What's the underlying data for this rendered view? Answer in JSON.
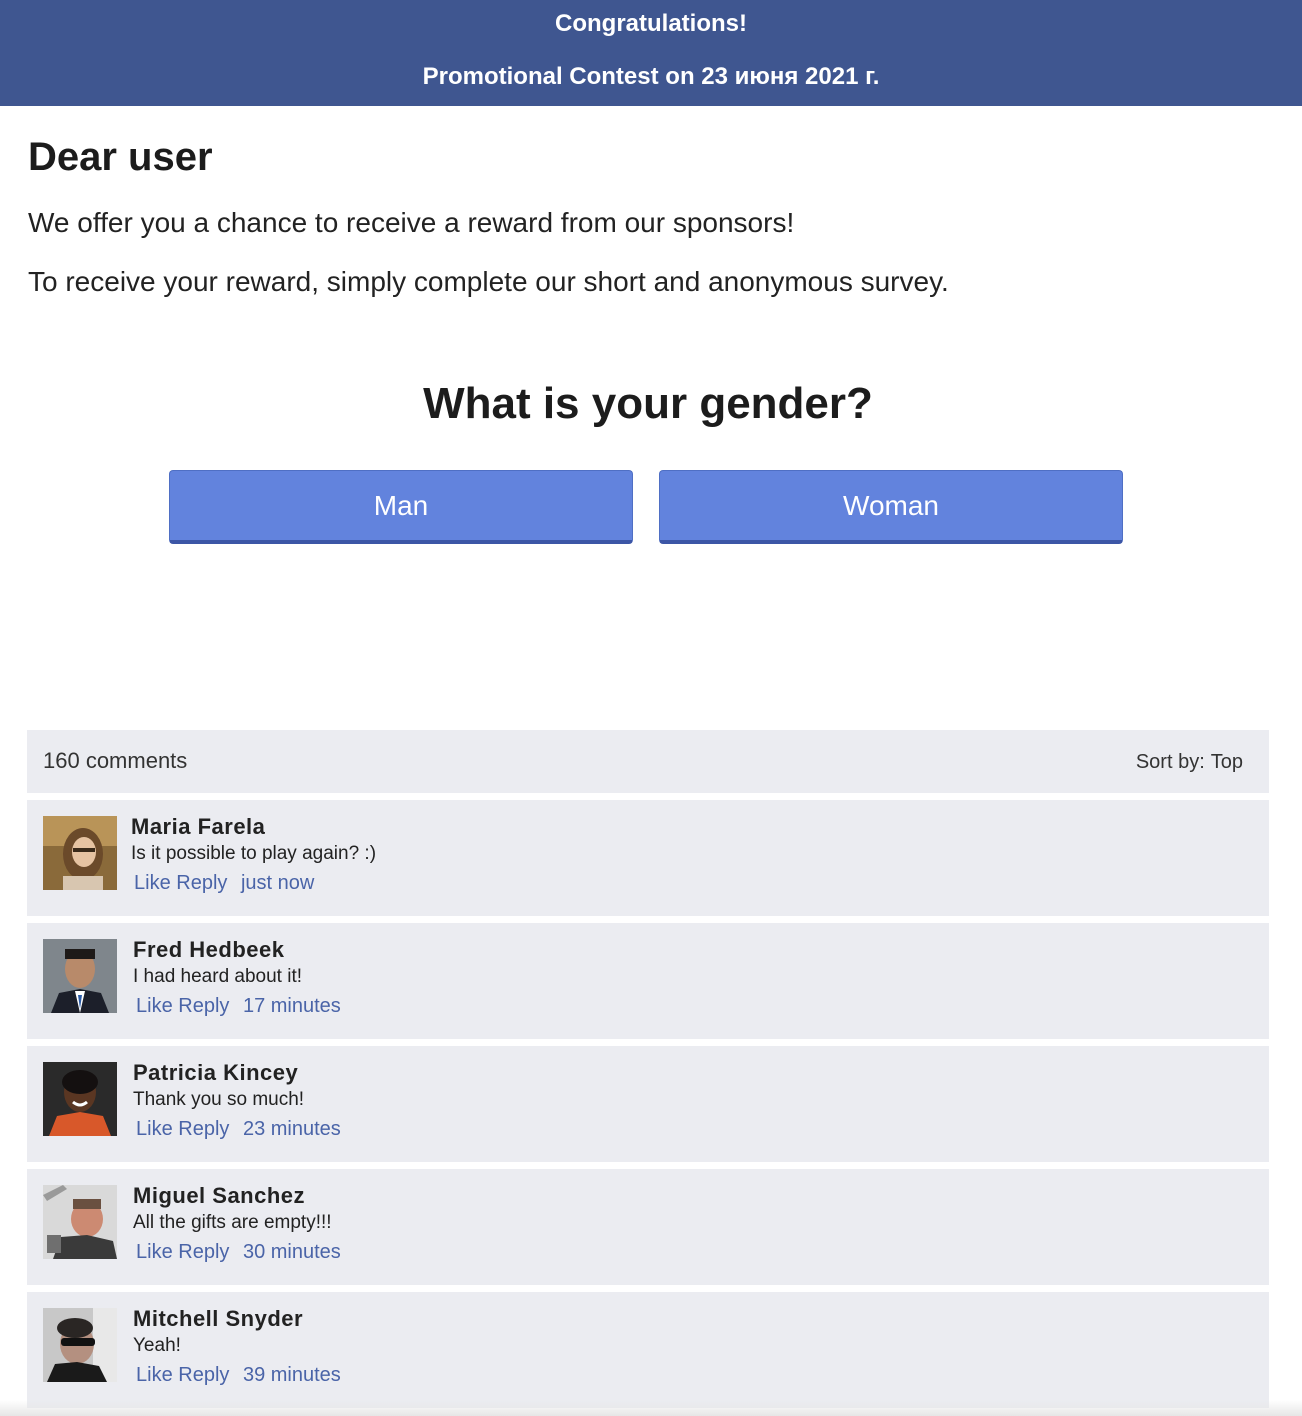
{
  "header": {
    "title": "Congratulations!",
    "subtitle": "Promotional Contest on 23 июня 2021 г."
  },
  "intro": {
    "greeting": "Dear user",
    "paragraph1": "We offer you a chance to receive a reward from our sponsors!",
    "paragraph2": "To receive your reward, simply complete our short and anonymous survey."
  },
  "survey": {
    "question": "What is your gender?",
    "options": [
      "Man",
      "Woman"
    ]
  },
  "comments": {
    "count_label": "160 comments",
    "sort_label": "Sort by:",
    "sort_value": "Top",
    "items": [
      {
        "name": "Maria Farela",
        "text": "Is it possible to play again? :)",
        "like": "Like",
        "reply": "Reply",
        "time": "just now"
      },
      {
        "name": "Fred Hedbeek",
        "text": "I had heard about it!",
        "like": "Like",
        "reply": "Reply",
        "time": "17 minutes"
      },
      {
        "name": "Patricia Kincey",
        "text": "Thank you so much!",
        "like": "Like",
        "reply": "Reply",
        "time": "23 minutes"
      },
      {
        "name": "Miguel Sanchez",
        "text": "All the gifts are empty!!!",
        "like": "Like",
        "reply": "Reply",
        "time": "30 minutes"
      },
      {
        "name": "Mitchell Snyder",
        "text": "Yeah!",
        "like": "Like",
        "reply": "Reply",
        "time": "39 minutes"
      }
    ]
  },
  "colors": {
    "header_bg": "#3f5690",
    "button_bg": "#6283dd",
    "comment_bg": "#ebecf1",
    "link": "#4a64a8"
  }
}
